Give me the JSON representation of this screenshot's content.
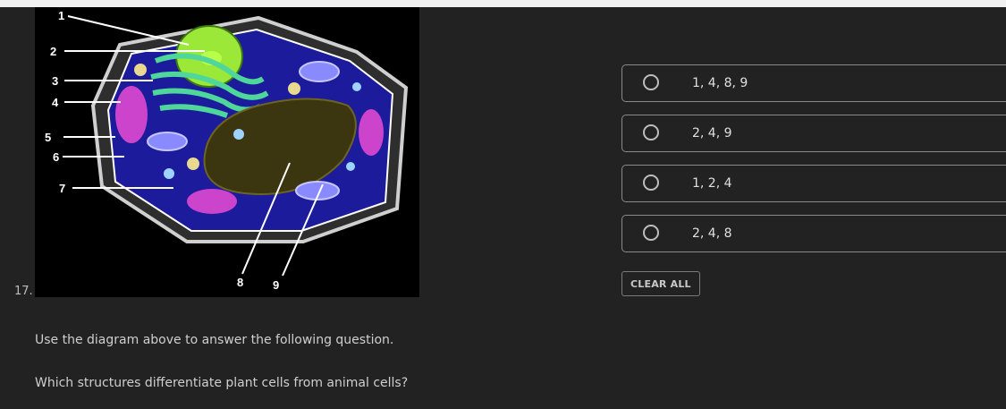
{
  "question": {
    "number": "17.",
    "instruction": "Use the diagram above to answer the following question.",
    "prompt": "Which structures differentiate plant cells from animal cells?"
  },
  "diagram": {
    "labels": [
      "1",
      "2",
      "3",
      "4",
      "5",
      "6",
      "7",
      "8",
      "9"
    ]
  },
  "options": [
    {
      "label": "1, 4, 8, 9"
    },
    {
      "label": "2, 4, 9"
    },
    {
      "label": "1, 2, 4"
    },
    {
      "label": "2, 4, 8"
    }
  ],
  "clear_all_label": "CLEAR ALL",
  "colors": {
    "background": "#222222",
    "option_border": "#8a8a8a",
    "vacuole": "#3b3510",
    "chloroplast": "#cc44cc",
    "cytoplasm": "#1a1a9a",
    "nucleus": "#99ee33"
  }
}
